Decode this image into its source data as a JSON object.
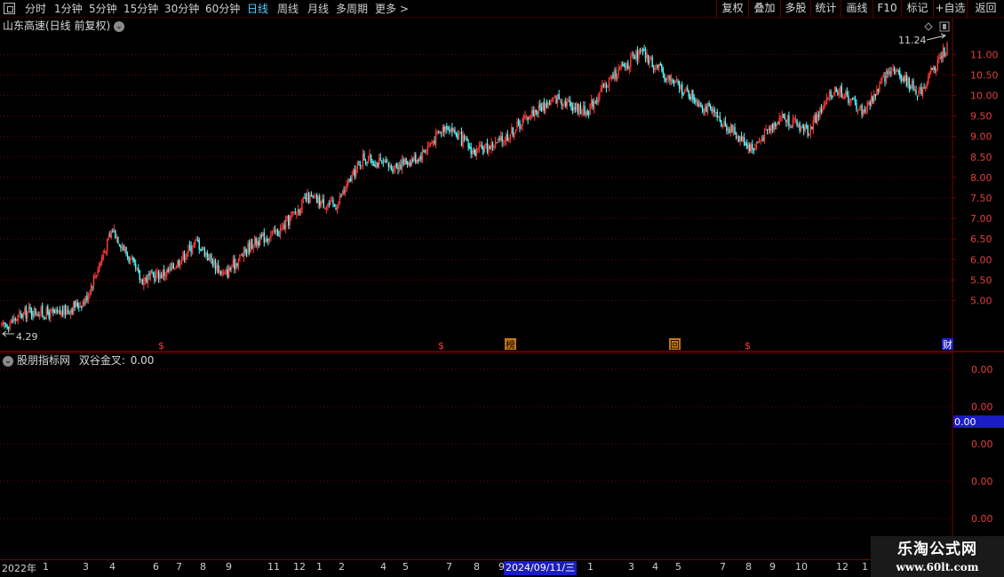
{
  "toolbar": {
    "periods": [
      "分时",
      "1分钟",
      "5分钟",
      "15分钟",
      "30分钟",
      "60分钟",
      "日线",
      "周线",
      "月线",
      "多周期"
    ],
    "active_period": "日线",
    "more_label": "更多 >",
    "right_buttons": [
      "复权",
      "叠加",
      "多股",
      "统计",
      "画线",
      "F10",
      "标记",
      "+自选",
      "返回"
    ]
  },
  "main_panel": {
    "title": "山东高速(日线 前复权)",
    "high_label": "11.24",
    "low_label": "4.29",
    "event_markers": [
      "$",
      "$",
      "榜",
      "回",
      "$",
      "财"
    ]
  },
  "indicator_panel": {
    "title": "股朋指标网",
    "indicator": "双谷金叉:",
    "indicator_value": "0.00",
    "axis_ticks": [
      "0.00",
      "0.00",
      "0.00",
      "0.00",
      "0.00"
    ],
    "current_value": "0.00"
  },
  "time_axis": {
    "labels": [
      "2022年",
      "1",
      "3",
      "4",
      "6",
      "7",
      "8",
      "9",
      "11",
      "12",
      "1",
      "2",
      "4",
      "5",
      "7",
      "8",
      "9",
      "1",
      "3",
      "4",
      "5",
      "7",
      "8",
      "9",
      "10",
      "12",
      "1"
    ],
    "highlight_date": "2024/09/11/三"
  },
  "watermark": {
    "title": "乐淘公式网",
    "url": "www.60lt.com"
  },
  "colors": {
    "background": "#000000",
    "up_candle": "#ff3a3a",
    "down_candle": "#54ffff",
    "grid": "#7a0000",
    "active_tab": "#4fd2ff",
    "axis_text": "#e04040"
  },
  "chart_data": {
    "type": "candlestick",
    "y_axis_ticks": [
      5.0,
      5.5,
      6.0,
      6.5,
      7.0,
      7.5,
      8.0,
      8.5,
      9.0,
      9.5,
      10.0,
      10.5,
      11.0
    ],
    "ylim": [
      4.1,
      11.55
    ],
    "period_high": 11.24,
    "period_low": 4.29,
    "trend_anchors": [
      [
        "2022-01",
        4.35
      ],
      [
        "2022-03",
        4.75
      ],
      [
        "2022-04",
        4.65
      ],
      [
        "2022-05",
        5.0
      ],
      [
        "2022-06",
        6.75
      ],
      [
        "2022-07",
        5.5
      ],
      [
        "2022-08",
        5.7
      ],
      [
        "2022-09",
        6.45
      ],
      [
        "2022-10",
        5.6
      ],
      [
        "2022-11",
        6.4
      ],
      [
        "2022-12",
        6.7
      ],
      [
        "2023-01",
        7.5
      ],
      [
        "2023-02",
        7.3
      ],
      [
        "2023-03",
        8.5
      ],
      [
        "2023-04",
        8.25
      ],
      [
        "2023-05",
        8.5
      ],
      [
        "2023-06",
        9.3
      ],
      [
        "2023-07",
        8.6
      ],
      [
        "2023-08",
        8.9
      ],
      [
        "2023-09",
        9.55
      ],
      [
        "2023-10",
        9.95
      ],
      [
        "2023-11",
        9.6
      ],
      [
        "2023-12",
        10.5
      ],
      [
        "2024-01",
        11.05
      ],
      [
        "2024-02",
        10.4
      ],
      [
        "2024-03",
        9.9
      ],
      [
        "2024-04",
        9.3
      ],
      [
        "2024-05",
        8.7
      ],
      [
        "2024-06",
        9.5
      ],
      [
        "2024-07",
        9.15
      ],
      [
        "2024-08",
        10.2
      ],
      [
        "2024-09",
        9.6
      ],
      [
        "2024-10",
        10.7
      ],
      [
        "2024-11",
        10.05
      ],
      [
        "2024-12",
        11.2
      ]
    ]
  }
}
